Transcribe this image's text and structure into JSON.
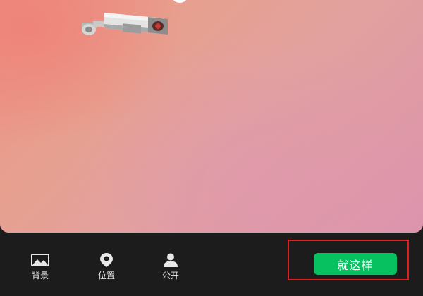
{
  "toolbar": {
    "items": [
      {
        "label": "背景",
        "icon": "background-image-icon"
      },
      {
        "label": "位置",
        "icon": "location-pin-icon"
      },
      {
        "label": "公开",
        "icon": "person-icon"
      }
    ],
    "confirm_label": "就这样"
  },
  "preview": {
    "sticker": "security-camera"
  },
  "colors": {
    "confirm_button": "#07c160",
    "highlight_border": "#e0201c",
    "toolbar_bg": "#1c1c1c"
  }
}
